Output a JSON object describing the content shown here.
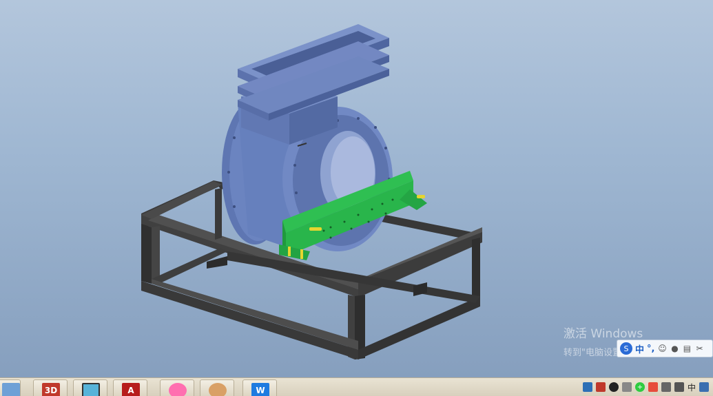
{
  "watermark": {
    "title": "激活 Windows",
    "subtitle": "转到\"电脑设置\"以激活 Windows。"
  },
  "ime": {
    "logo": "S",
    "mode": "中",
    "punct": "°,",
    "icons": [
      "smiley-icon",
      "mic-icon",
      "keyboard-icon",
      "scissors-icon",
      "user-icon"
    ]
  },
  "taskbar": {
    "apps": [
      {
        "name": "explorer-app",
        "label": ""
      },
      {
        "name": "3d-app",
        "label": "3D"
      },
      {
        "name": "notepad-app",
        "label": ""
      },
      {
        "name": "autocad-app",
        "label": "A"
      },
      {
        "name": "photos-app",
        "label": ""
      },
      {
        "name": "game-app",
        "label": ""
      },
      {
        "name": "wps-app",
        "label": "W"
      }
    ],
    "tray_text": "中",
    "tray_icons": [
      "network-icon",
      "app-tray-icon",
      "qq-icon",
      "gallery-icon",
      "plus-icon",
      "security-icon",
      "signal-icon",
      "volume-icon",
      "ime-tray-icon"
    ]
  },
  "colors": {
    "background_top": "#b3c6dc",
    "valve_body": "#6b84c0",
    "frame": "#353535",
    "bracket": "#29b54b",
    "pin": "#e5d530"
  }
}
